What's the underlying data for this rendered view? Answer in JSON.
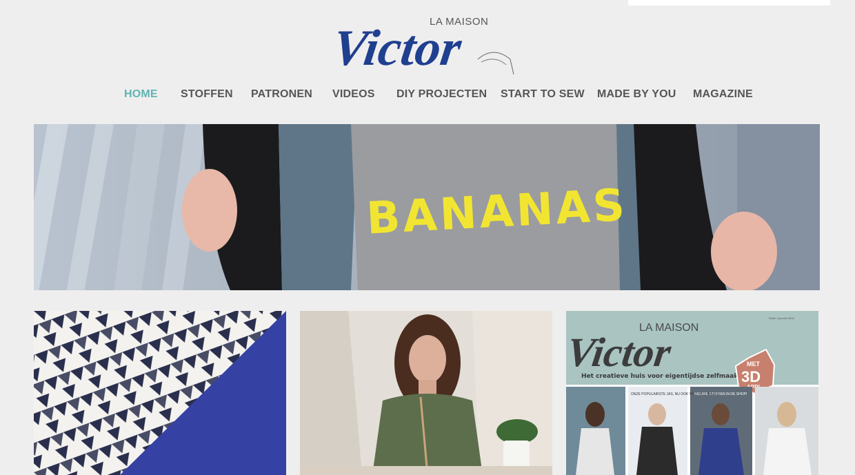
{
  "brand": {
    "logo_prefix": "LA MAISON",
    "logo_name": "Victor"
  },
  "nav": {
    "items": [
      {
        "label": "HOME",
        "active": true
      },
      {
        "label": "STOFFEN",
        "active": false
      },
      {
        "label": "PATRONEN",
        "active": false
      },
      {
        "label": "VIDEOS",
        "active": false
      },
      {
        "label": "DIY PROJECTEN",
        "active": false
      },
      {
        "label": "START TO SEW",
        "active": false
      },
      {
        "label": "MADE BY YOU",
        "active": false
      },
      {
        "label": "MAGAZINE",
        "active": false
      }
    ]
  },
  "hero": {
    "shirt_text": "BANANAS"
  },
  "cards": {
    "magazine": {
      "prefix": "LA MAISON",
      "name": "Victor",
      "tagline": "Het creatieve huis voor eigentijdse zelfmaakmode",
      "badge_top": "MET",
      "badge_main": "3D",
      "badge_bottom": "APP!",
      "edition": "Editie 1 jan-feb 2016",
      "cover_note_1": "ONZE POPULAIRSTE JAS, NU OOK VOOR KLEINTJES",
      "cover_note_2": "NIEUWE STOFFEN IN DE SHOP!"
    }
  },
  "colors": {
    "background": "#efeeee",
    "nav_text": "#555555",
    "nav_active": "#5fb5b3",
    "logo_blue": "#1f3f8f"
  }
}
